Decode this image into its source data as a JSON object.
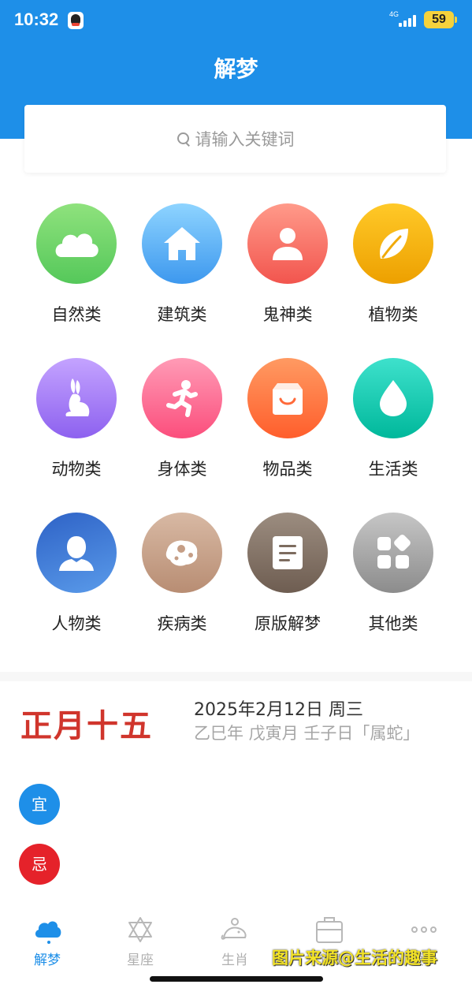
{
  "status_bar": {
    "time": "10:32",
    "network": "4G",
    "battery": "59"
  },
  "header": {
    "title": "解梦"
  },
  "search": {
    "placeholder": "请输入关键词"
  },
  "categories": [
    {
      "label": "自然类",
      "icon": "cloud-icon"
    },
    {
      "label": "建筑类",
      "icon": "house-icon"
    },
    {
      "label": "鬼神类",
      "icon": "person-icon"
    },
    {
      "label": "植物类",
      "icon": "leaf-icon"
    },
    {
      "label": "动物类",
      "icon": "rabbit-icon"
    },
    {
      "label": "身体类",
      "icon": "running-person-icon"
    },
    {
      "label": "物品类",
      "icon": "shopping-bag-icon"
    },
    {
      "label": "生活类",
      "icon": "water-drop-icon"
    },
    {
      "label": "人物类",
      "icon": "user-icon"
    },
    {
      "label": "疾病类",
      "icon": "virus-icon"
    },
    {
      "label": "原版解梦",
      "icon": "document-icon"
    },
    {
      "label": "其他类",
      "icon": "apps-icon"
    }
  ],
  "calendar": {
    "lunar_date": "正月十五",
    "solar_date": "2025年2月12日 周三",
    "ganzhi": "乙巳年 戊寅月 壬子日「属蛇」",
    "yi_label": "宜",
    "ji_label": "忌"
  },
  "tabbar": {
    "items": [
      {
        "label": "解梦",
        "icon": "cloud-icon",
        "active": true
      },
      {
        "label": "星座",
        "icon": "star-of-david-icon",
        "active": false
      },
      {
        "label": "生肖",
        "icon": "zodiac-mouse-icon",
        "active": false
      },
      {
        "label": "工具",
        "icon": "toolbox-icon",
        "active": false
      },
      {
        "label": "更多",
        "icon": "more-dots-icon",
        "active": false
      }
    ]
  },
  "watermark": "图片来源@生活的趣事",
  "colors": {
    "primary": "#1e8fe8",
    "lunar_red": "#d0352c",
    "ji_red": "#e5222a"
  }
}
